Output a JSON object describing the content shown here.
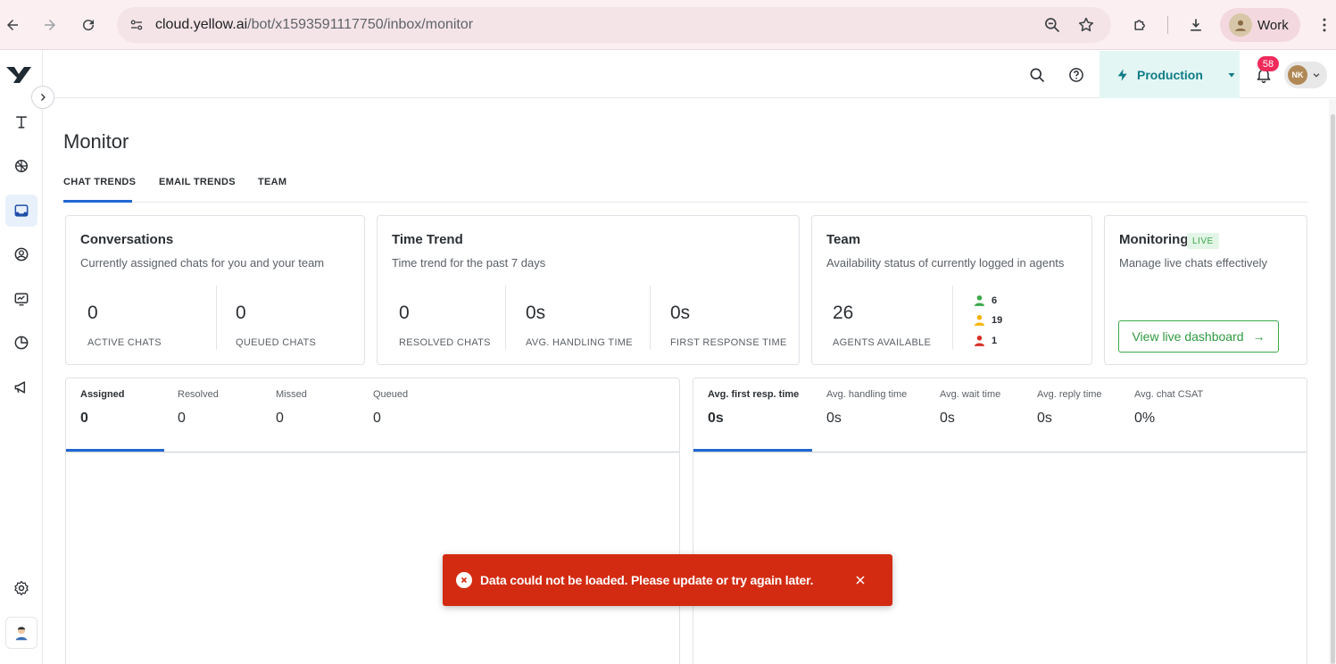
{
  "browser": {
    "url_host": "cloud.yellow.ai",
    "url_path": "/bot/x1593591117750/inbox/monitor",
    "profile_label": "Work"
  },
  "header": {
    "environment": "Production",
    "notification_count": "58",
    "user_initials": "NK"
  },
  "page": {
    "title": "Monitor",
    "tabs": [
      {
        "label": "CHAT TRENDS",
        "active": true
      },
      {
        "label": "EMAIL TRENDS",
        "active": false
      },
      {
        "label": "TEAM",
        "active": false
      }
    ]
  },
  "cards": {
    "conversations": {
      "title": "Conversations",
      "subtitle": "Currently assigned chats for you and your team",
      "metrics": [
        {
          "value": "0",
          "label": "ACTIVE CHATS"
        },
        {
          "value": "0",
          "label": "QUEUED CHATS"
        }
      ]
    },
    "time_trend": {
      "title": "Time Trend",
      "subtitle": "Time trend for the past 7 days",
      "metrics": [
        {
          "value": "0",
          "label": "RESOLVED CHATS"
        },
        {
          "value": "0s",
          "label": "AVG. HANDLING TIME"
        },
        {
          "value": "0s",
          "label": "FIRST RESPONSE TIME"
        }
      ]
    },
    "team": {
      "title": "Team",
      "subtitle": "Availability status of currently logged in agents",
      "agents_available": {
        "value": "26",
        "label": "AGENTS AVAILABLE"
      },
      "status_counts": [
        {
          "count": "6",
          "color": "#3aa84a",
          "icon": "agent-available-icon"
        },
        {
          "count": "19",
          "color": "#f4b400",
          "icon": "agent-away-icon"
        },
        {
          "count": "1",
          "color": "#d93025",
          "icon": "agent-busy-icon"
        }
      ]
    },
    "monitoring": {
      "title": "Monitoring",
      "live_tag": "LIVE",
      "subtitle": "Manage live chats effectively",
      "button_label": "View live dashboard",
      "button_arrow": "→"
    }
  },
  "chat_panel": {
    "tabs": [
      {
        "label": "Assigned",
        "value": "0",
        "active": true
      },
      {
        "label": "Resolved",
        "value": "0",
        "active": false
      },
      {
        "label": "Missed",
        "value": "0",
        "active": false
      },
      {
        "label": "Queued",
        "value": "0",
        "active": false
      }
    ]
  },
  "time_panel": {
    "tabs": [
      {
        "label": "Avg. first resp. time",
        "value": "0s",
        "active": true
      },
      {
        "label": "Avg. handling time",
        "value": "0s",
        "active": false
      },
      {
        "label": "Avg. wait time",
        "value": "0s",
        "active": false
      },
      {
        "label": "Avg. reply time",
        "value": "0s",
        "active": false
      },
      {
        "label": "Avg. chat CSAT",
        "value": "0%",
        "active": false
      }
    ]
  },
  "toast": {
    "message": "Data could not be loaded. Please update or try again later."
  },
  "colors": {
    "accent": "#2167d2",
    "error": "#d32b12",
    "success": "#3aa84a",
    "env_text": "#0e7c86"
  }
}
